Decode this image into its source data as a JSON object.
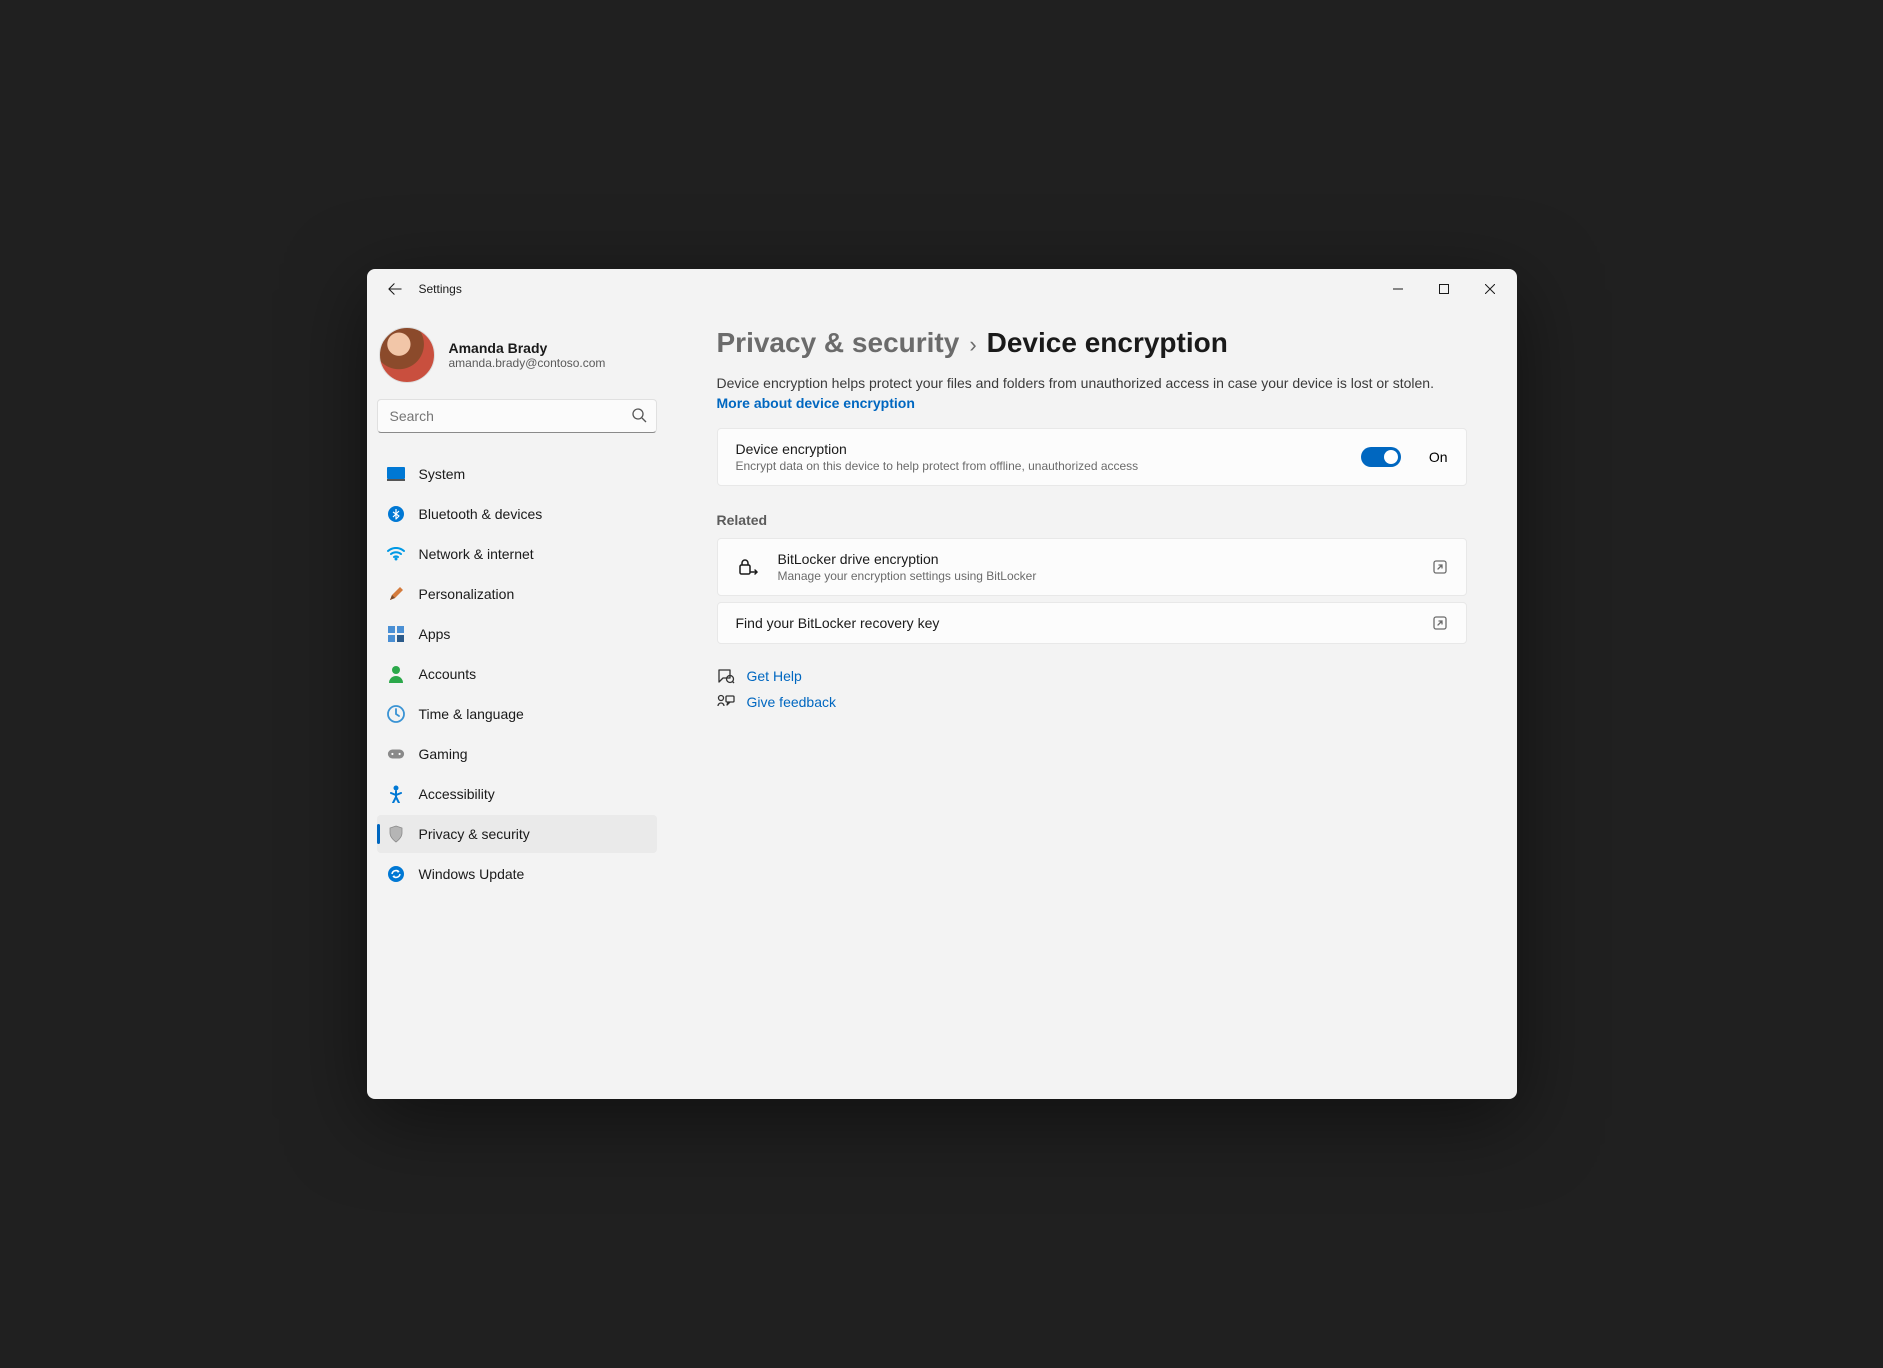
{
  "window": {
    "title": "Settings"
  },
  "user": {
    "name": "Amanda Brady",
    "email": "amanda.brady@contoso.com"
  },
  "search": {
    "placeholder": "Search"
  },
  "nav": {
    "items": [
      {
        "label": "System"
      },
      {
        "label": "Bluetooth & devices"
      },
      {
        "label": "Network & internet"
      },
      {
        "label": "Personalization"
      },
      {
        "label": "Apps"
      },
      {
        "label": "Accounts"
      },
      {
        "label": "Time & language"
      },
      {
        "label": "Gaming"
      },
      {
        "label": "Accessibility"
      },
      {
        "label": "Privacy & security"
      },
      {
        "label": "Windows Update"
      }
    ],
    "active_index": 9
  },
  "breadcrumb": {
    "parent": "Privacy & security",
    "current": "Device encryption"
  },
  "description": {
    "text": "Device encryption helps protect your files and folders from unauthorized access in case your device is lost or stolen. ",
    "link": "More about device encryption"
  },
  "encryption_card": {
    "title": "Device encryption",
    "subtitle": "Encrypt data on this device to help protect from offline, unauthorized access",
    "toggle_state": "On"
  },
  "related": {
    "heading": "Related",
    "items": [
      {
        "title": "BitLocker drive encryption",
        "subtitle": "Manage your encryption settings using BitLocker",
        "has_icon": true
      },
      {
        "title": "Find your BitLocker recovery key",
        "subtitle": "",
        "has_icon": false
      }
    ]
  },
  "help": {
    "get_help": "Get Help",
    "feedback": "Give feedback"
  }
}
